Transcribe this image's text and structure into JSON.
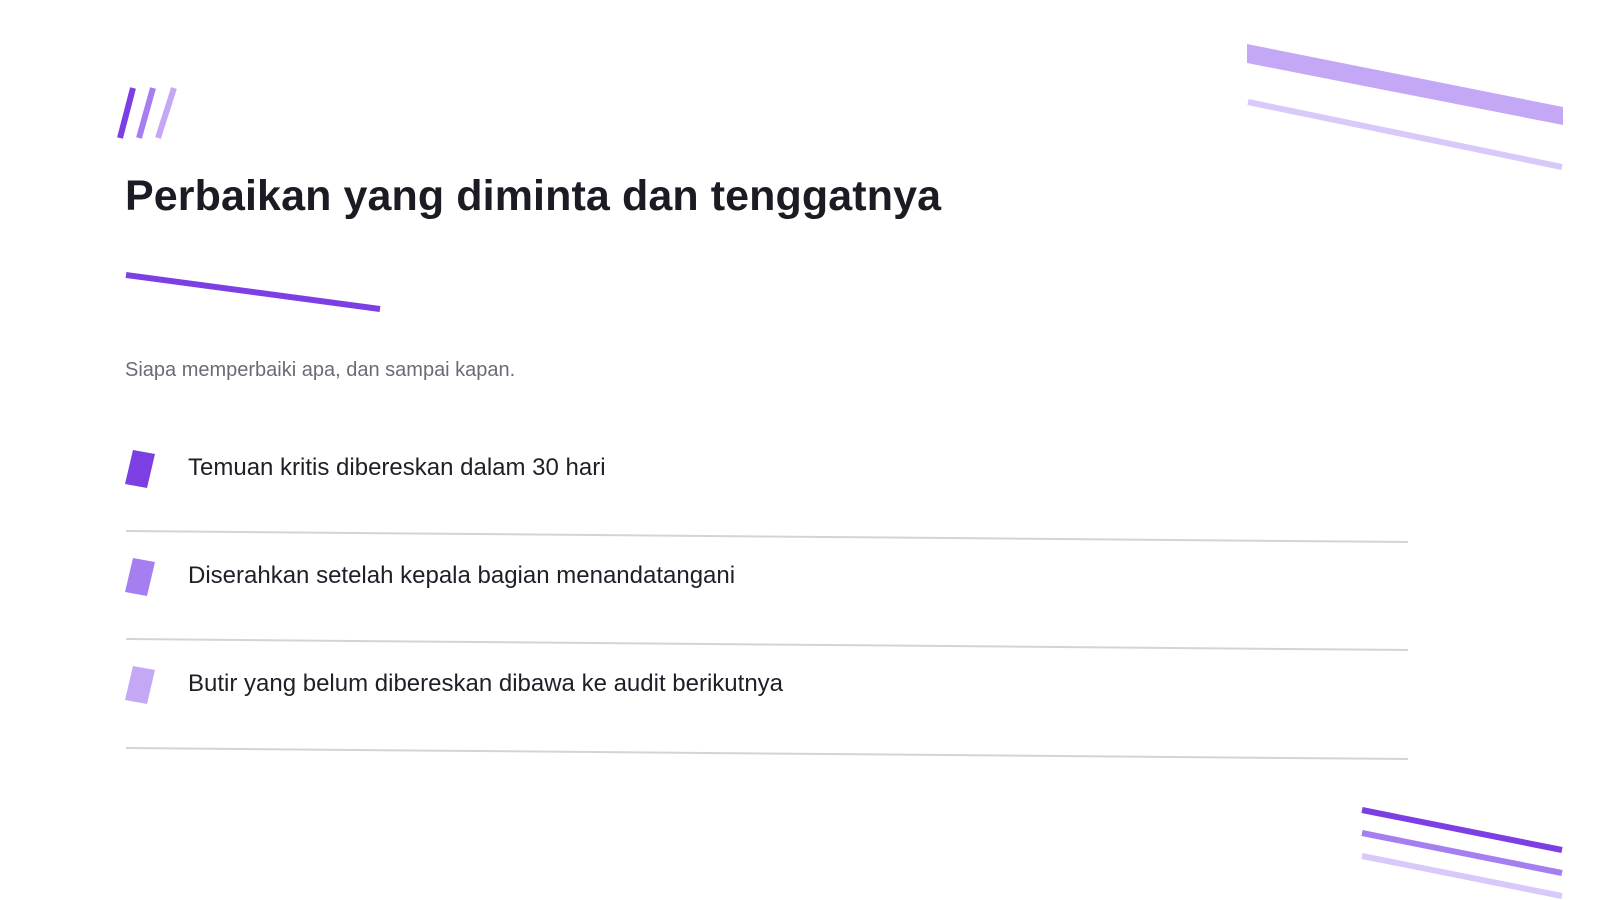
{
  "slide": {
    "title": "Perbaikan yang diminta dan tenggatnya",
    "subtitle": "Siapa memperbaiki apa, dan sampai kapan."
  },
  "items": [
    {
      "text": "Temuan kritis dibereskan dalam 30 hari",
      "marker_color": "#7b3fe4"
    },
    {
      "text": "Diserahkan setelah kepala bagian menandatangani",
      "marker_color": "#a57ff0"
    },
    {
      "text": "Butir yang belum dibereskan dibawa ke audit berikutnya",
      "marker_color": "#c4a8f5"
    }
  ],
  "colors": {
    "accent": "#7b3fe4",
    "accent_mid": "#a57ff0",
    "accent_light": "#c4a8f5",
    "title_text": "#1b1b23",
    "subtitle_text": "#6b6b78",
    "divider": "#d4d4d8"
  }
}
